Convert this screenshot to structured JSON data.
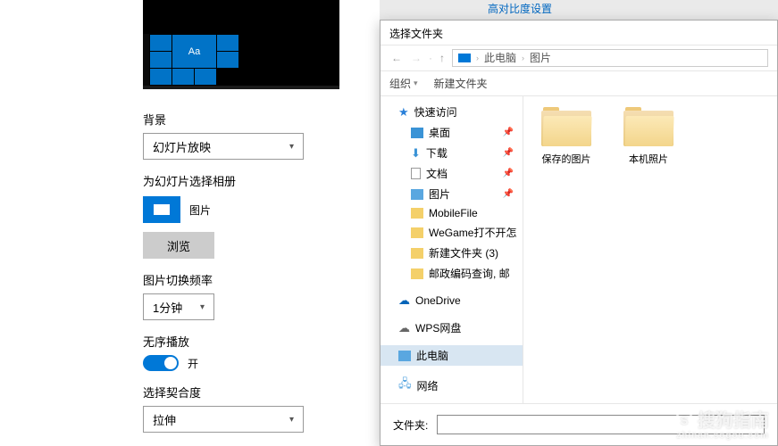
{
  "settings": {
    "preview_tile_text": "Aa",
    "bg_label": "背景",
    "bg_value": "幻灯片放映",
    "album_section": "为幻灯片选择相册",
    "album_name": "图片",
    "browse": "浏览",
    "freq_label": "图片切换频率",
    "freq_value": "1分钟",
    "shuffle_label": "无序播放",
    "shuffle_state": "开",
    "fit_label": "选择契合度",
    "fit_value": "拉伸"
  },
  "links": {
    "l1": "高对比度设置"
  },
  "dialog": {
    "title": "选择文件夹",
    "crumb1": "此电脑",
    "crumb2": "图片",
    "org": "组织",
    "newfolder": "新建文件夹",
    "sidebar": {
      "quick": "快速访问",
      "desktop": "桌面",
      "downloads": "下载",
      "documents": "文档",
      "pictures": "图片",
      "mobilefile": "MobileFile",
      "wegame": "WeGame打不开怎",
      "newfolder3": "新建文件夹 (3)",
      "postal": "邮政编码查询, 邮",
      "onedrive": "OneDrive",
      "wps": "WPS网盘",
      "thispc": "此电脑",
      "network": "网络"
    },
    "content": {
      "saved": "保存的图片",
      "camera": "本机照片"
    },
    "footer_label": "文件夹:"
  },
  "watermark": {
    "brand": "搜狗指南",
    "sub": "zhinan.sogou.com"
  }
}
